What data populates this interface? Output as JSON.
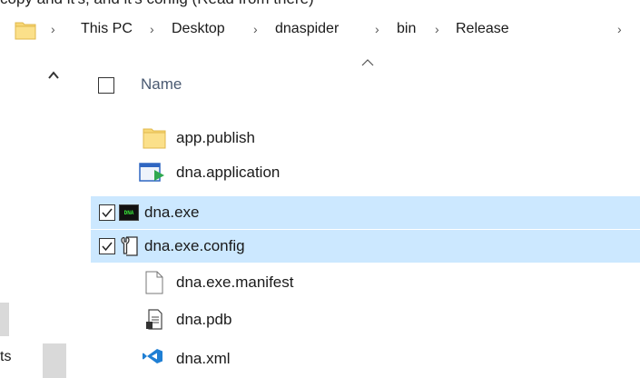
{
  "top_strip_text": "copy and it's, and it's config (Read from there)",
  "breadcrumb": [
    "This PC",
    "Desktop",
    "dnaspider",
    "bin",
    "Release"
  ],
  "breadcrumb_separator": "›",
  "column_header": {
    "name": "Name"
  },
  "nav": {
    "label": "ts"
  },
  "files": [
    {
      "name": "app.publish",
      "icon": "folder-icon",
      "selected": false,
      "checked": false
    },
    {
      "name": "dna.application",
      "icon": "application-manifest-icon",
      "selected": false,
      "checked": false
    },
    {
      "name": "dna.exe",
      "icon": "dna-exe-icon",
      "selected": true,
      "checked": true
    },
    {
      "name": "dna.exe.config",
      "icon": "config-file-icon",
      "selected": true,
      "checked": true
    },
    {
      "name": "dna.exe.manifest",
      "icon": "blank-file-icon",
      "selected": false,
      "checked": false
    },
    {
      "name": "dna.pdb",
      "icon": "pdb-file-icon",
      "selected": false,
      "checked": false
    },
    {
      "name": "dna.xml",
      "icon": "visual-studio-icon",
      "selected": false,
      "checked": false
    }
  ],
  "exe_icon_text": "DNA",
  "colors": {
    "selection": "#cce8ff",
    "folder": "#f8d775",
    "header_text": "#4a5a72",
    "vs_blue": "#1f7fd4"
  }
}
